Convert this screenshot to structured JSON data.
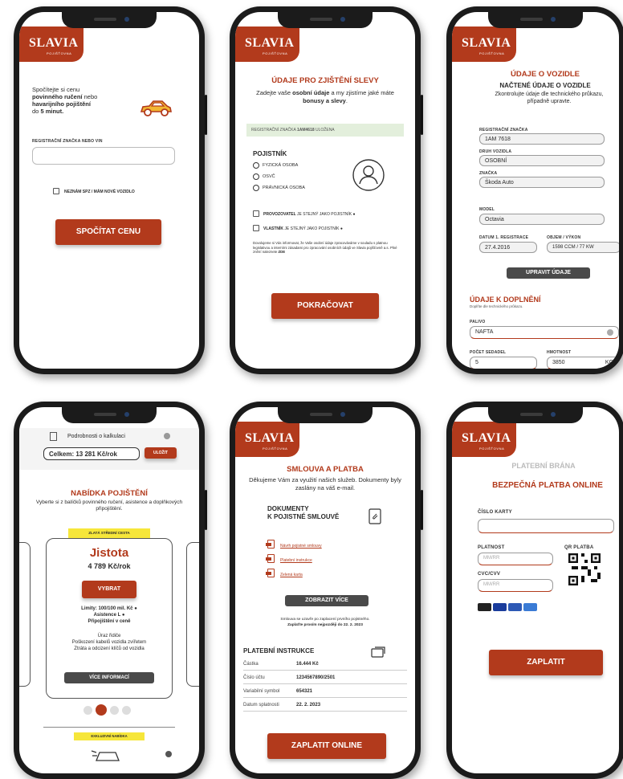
{
  "brand": {
    "name": "SLAVIA",
    "sub": "POJIŠŤOVNA",
    "accent": "#b23a1c"
  },
  "s1": {
    "intro_1": "Spočítejte si cenu",
    "intro_2": "povinného ručení",
    "intro_3": " nebo",
    "intro_4": "havarijního pojištění",
    "intro_5": "do ",
    "intro_6": "5 minut.",
    "field_label": "REGISTRAČNÍ ZNAČKA NEBO VIN",
    "field_value": "",
    "checkbox_label": "NEZNÁM SPZ / MÁM NOVÉ VOZIDLO",
    "cta": "SPOČÍTAT CENU",
    "car_icon": "car-icon"
  },
  "s2": {
    "title": "ÚDAJE PRO ZJIŠTĚNÍ SLEVY",
    "intro_a": "Zadejte vaše ",
    "intro_b": "osobní údaje",
    "intro_c": " a my",
    "intro_d": "zjistíme jaké máte ",
    "intro_e": "bonusy a slevy",
    "intro_f": ".",
    "banner_a": "REGISTRAČNÍ ZNAČKA ",
    "banner_b": "1AM4618",
    "banner_c": " ULOŽENA",
    "policy_title": "POJISTNÍK",
    "options": [
      "FYZICKÁ OSOBA",
      "OSVČ",
      "PRÁVNICKÁ OSOBA"
    ],
    "check1_a": "PROVOZOVATEL",
    "check1_b": " JE STEJNÝ JAKO POJISTNÍK",
    "check2_a": "VLASTNÍK",
    "check2_b": " JE STEJNÝ JAKO POJISTNÍK",
    "legal": "Dovolujeme si Vás informovat, že Vaše osobní údaje zpracováváme v souladu s platnou legislativou a interními zásadami pro zpracování osobních údajů ve Slavia pojišťovně a.s. Plné znění naleznete ",
    "legal_link": "ZDE",
    "cta": "POKRAČOVAT"
  },
  "s3": {
    "title": "ÚDAJE O VOZIDLE",
    "subtitle": "NAČTENÉ ÚDAJE O VOZIDLE",
    "desc": "Zkontrolujte údaje dle technického průkazu, případně upravte.",
    "fields": [
      {
        "label": "REGISTRAČNÍ ZNAČKA",
        "value": "1AM 7618"
      },
      {
        "label": "DRUH VOZIDLA",
        "value": "OSOBNÍ"
      },
      {
        "label": "ZNAČKA",
        "value": "Škoda Auto"
      },
      {
        "label": "MODEL",
        "value": "Octavia"
      }
    ],
    "reg_date_label": "DATUM 1. REGISTRACE",
    "reg_date_value": "27.4.2016",
    "volume_label": "OBJEM / VÝKON",
    "volume_value": "1598 CCM / 77 KW",
    "edit_btn": "UPRAVIT ÚDAJE",
    "section2_title": "ÚDAJE K DOPLNĚNÍ",
    "section2_desc": "Doplňte dle technického průkazu.",
    "fuel_label": "PALIVO",
    "fuel_value": "NAFTA",
    "seats_label": "POČET SEDADEL",
    "seats_value": "5",
    "weight_label": "HMOTNOST",
    "weight_value": "3850",
    "weight_unit": "KG"
  },
  "s4": {
    "calc_label": "Podrobnosti o kalkulaci",
    "total": "Celkem: 13 281 Kč/rok",
    "save_btn": "ULOŽIT",
    "title": "NABÍDKA POJIŠTĚNÍ",
    "desc": "Vyberte si z balíčků povinného ručení, asistence a doplňkových připojištění.",
    "badge": "ZLATÁ STŘEDNÍ CESTA",
    "plan_name": "Jistota",
    "plan_price": "4 789 Kč/rok",
    "select_btn": "VYBRAT",
    "line1": "Limity: 100/100 mil. Kč",
    "line2": "Asistence L",
    "line3": "Připojištění v ceně",
    "extra1": "Úraz řidiče",
    "extra2": "Poškození kabelů vozidla zvířetem",
    "extra3": "Ztráta a odcizení klíčů od vozidla",
    "more_btn": "VÍCE INFORMACÍ",
    "badge2": "EXKLUZIVNÍ NABÍDKA",
    "carousel_index": 2,
    "carousel_count": 4
  },
  "s5": {
    "title": "SMLOUVA A PLATBA",
    "desc": "Děkujeme Vám za využití našich služeb. Dokumenty byly zaslány na váš e-mail.",
    "docs_title_1": "DOKUMENTY",
    "docs_title_2": "K POJISTNÉ SMLOUVĚ",
    "docs": [
      "Návrh pojistné smlouvy",
      "Platební instrukce",
      "Zelená karta"
    ],
    "more_btn": "ZOBRAZIT VÍCE",
    "note_1": "Smlouva se uzavře po zaplacení prvního pojistného.",
    "note_2": "Zaplaťte prosím nejpozději do 22. 2. 2023",
    "instr_title": "PLATEBNÍ INSTRUKCE",
    "rows": [
      {
        "k": "Částka",
        "v": "16.444 Kč"
      },
      {
        "k": "Číslo účtu",
        "v": "1234567890/2501"
      },
      {
        "k": "Variabilní symbol",
        "v": "654321"
      },
      {
        "k": "Datum splatnosti",
        "v": "22. 2. 2023"
      }
    ],
    "cta": "ZAPLATIT ONLINE"
  },
  "s6": {
    "gateway": "PLATEBNÍ BRÁNA",
    "title": "BEZPEČNÁ PLATBA ONLINE",
    "card_label": "ČÍSLO KARTY",
    "card_value": "",
    "validity_label": "PLATNOST",
    "validity_placeholder": "MM/RR",
    "qr_label": "QR PLATBA",
    "cvc_label": "CVC/CVV",
    "cvc_placeholder": "MM/RR",
    "cta": "ZAPLATIT"
  }
}
